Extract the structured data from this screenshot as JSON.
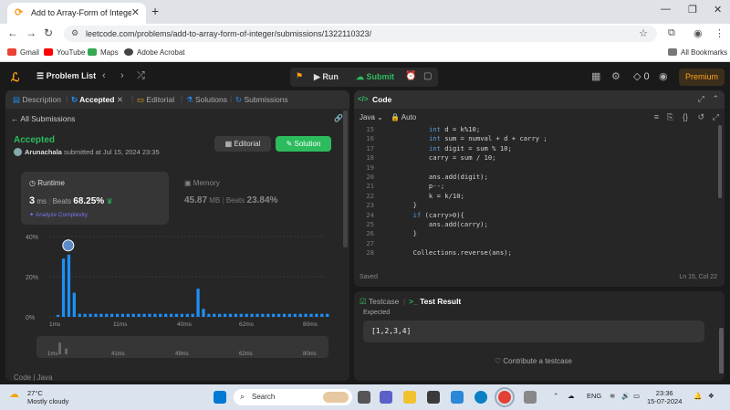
{
  "browser": {
    "tab_title": "Add to Array-Form of Integer -",
    "url": "leetcode.com/problems/add-to-array-form-of-integer/submissions/1322110323/",
    "bookmarks": [
      "Gmail",
      "YouTube",
      "Maps",
      "Adobe Acrobat"
    ],
    "all_bookmarks": "All Bookmarks"
  },
  "lc_nav": {
    "problem_list": "Problem List",
    "run": "Run",
    "submit": "Submit",
    "coins": "0",
    "premium": "Premium"
  },
  "left_tabs": [
    "Description",
    "Accepted",
    "Editorial",
    "Solutions",
    "Submissions"
  ],
  "submission": {
    "back_link": "All Submissions",
    "status": "Accepted",
    "author": "Arunachala",
    "submitted_text": "submitted at Jul 15, 2024 23:35",
    "editorial_btn": "Editorial",
    "solution_btn": "Solution",
    "runtime_label": "Runtime",
    "runtime_value": "3",
    "runtime_unit": "ms",
    "beats_label": "Beats",
    "runtime_beats": "68.25%",
    "analyze": "Analyze Complexity",
    "memory_label": "Memory",
    "memory_value": "45.87",
    "memory_unit": "MB",
    "memory_beats": "23.84%",
    "code_label": "Code | Java"
  },
  "chart_data": {
    "type": "bar",
    "y_ticks": [
      "40%",
      "20%",
      "0%"
    ],
    "ylim": [
      0,
      40
    ],
    "x_ticks": [
      "1ms",
      "11ms",
      "40ms",
      "62ms",
      "80ms"
    ],
    "minimap_ticks": [
      "1ms",
      "41ms",
      "49ms",
      "62ms",
      "80ms"
    ],
    "values": [
      1,
      29,
      31,
      12,
      1.5,
      1.5,
      1.5,
      1.5,
      1.5,
      1.5,
      1.5,
      1.5,
      1.5,
      1.5,
      1.5,
      1.5,
      1.5,
      1.5,
      1.5,
      1.5,
      1.5,
      1.5,
      1.5,
      1.5,
      1.5,
      1.5,
      14,
      4,
      1.5,
      1.5,
      1.5,
      1.5,
      1.5,
      1.5,
      1.5,
      1.5,
      1.5,
      1.5,
      1.5,
      1.5,
      1.5,
      1.5,
      1.5,
      1.5,
      1.5,
      1.5,
      1.5,
      1.5,
      1.5,
      1.5,
      1.5
    ],
    "highlight_index": 2,
    "color": "#1d8ff5"
  },
  "editor": {
    "title": "Code",
    "language": "Java",
    "mode": "Auto",
    "lines": [
      {
        "n": "15",
        "t": "            int d = k%10;"
      },
      {
        "n": "16",
        "t": "            int sum = numval + d + carry ;"
      },
      {
        "n": "17",
        "t": "            int digit = sum % 10;"
      },
      {
        "n": "18",
        "t": "            carry = sum / 10;"
      },
      {
        "n": "19",
        "t": ""
      },
      {
        "n": "20",
        "t": "            ans.add(digit);"
      },
      {
        "n": "21",
        "t": "            p--;"
      },
      {
        "n": "22",
        "t": "            k = k/10;"
      },
      {
        "n": "23",
        "t": "        }"
      },
      {
        "n": "24",
        "t": "        if (carry>0){"
      },
      {
        "n": "25",
        "t": "            ans.add(carry);"
      },
      {
        "n": "26",
        "t": "        }"
      },
      {
        "n": "27",
        "t": ""
      },
      {
        "n": "28",
        "t": "        Collections.reverse(ans);"
      }
    ],
    "status": "Saved",
    "cursor": "Ln 15, Col 22"
  },
  "testcase": {
    "tab1": "Testcase",
    "tab2": "Test Result",
    "expected_label": "Expected",
    "expected_value": "[1,2,3,4]",
    "contribute": "Contribute a testcase"
  },
  "taskbar": {
    "temp": "27°C",
    "weather": "Mostly cloudy",
    "search": "Search",
    "lang": "ENG",
    "time": "23:36",
    "date": "15-07-2024"
  },
  "colors": {
    "accent_green": "#2cbb5d",
    "brand_orange": "#ffa116",
    "bar_blue": "#1d8ff5"
  }
}
